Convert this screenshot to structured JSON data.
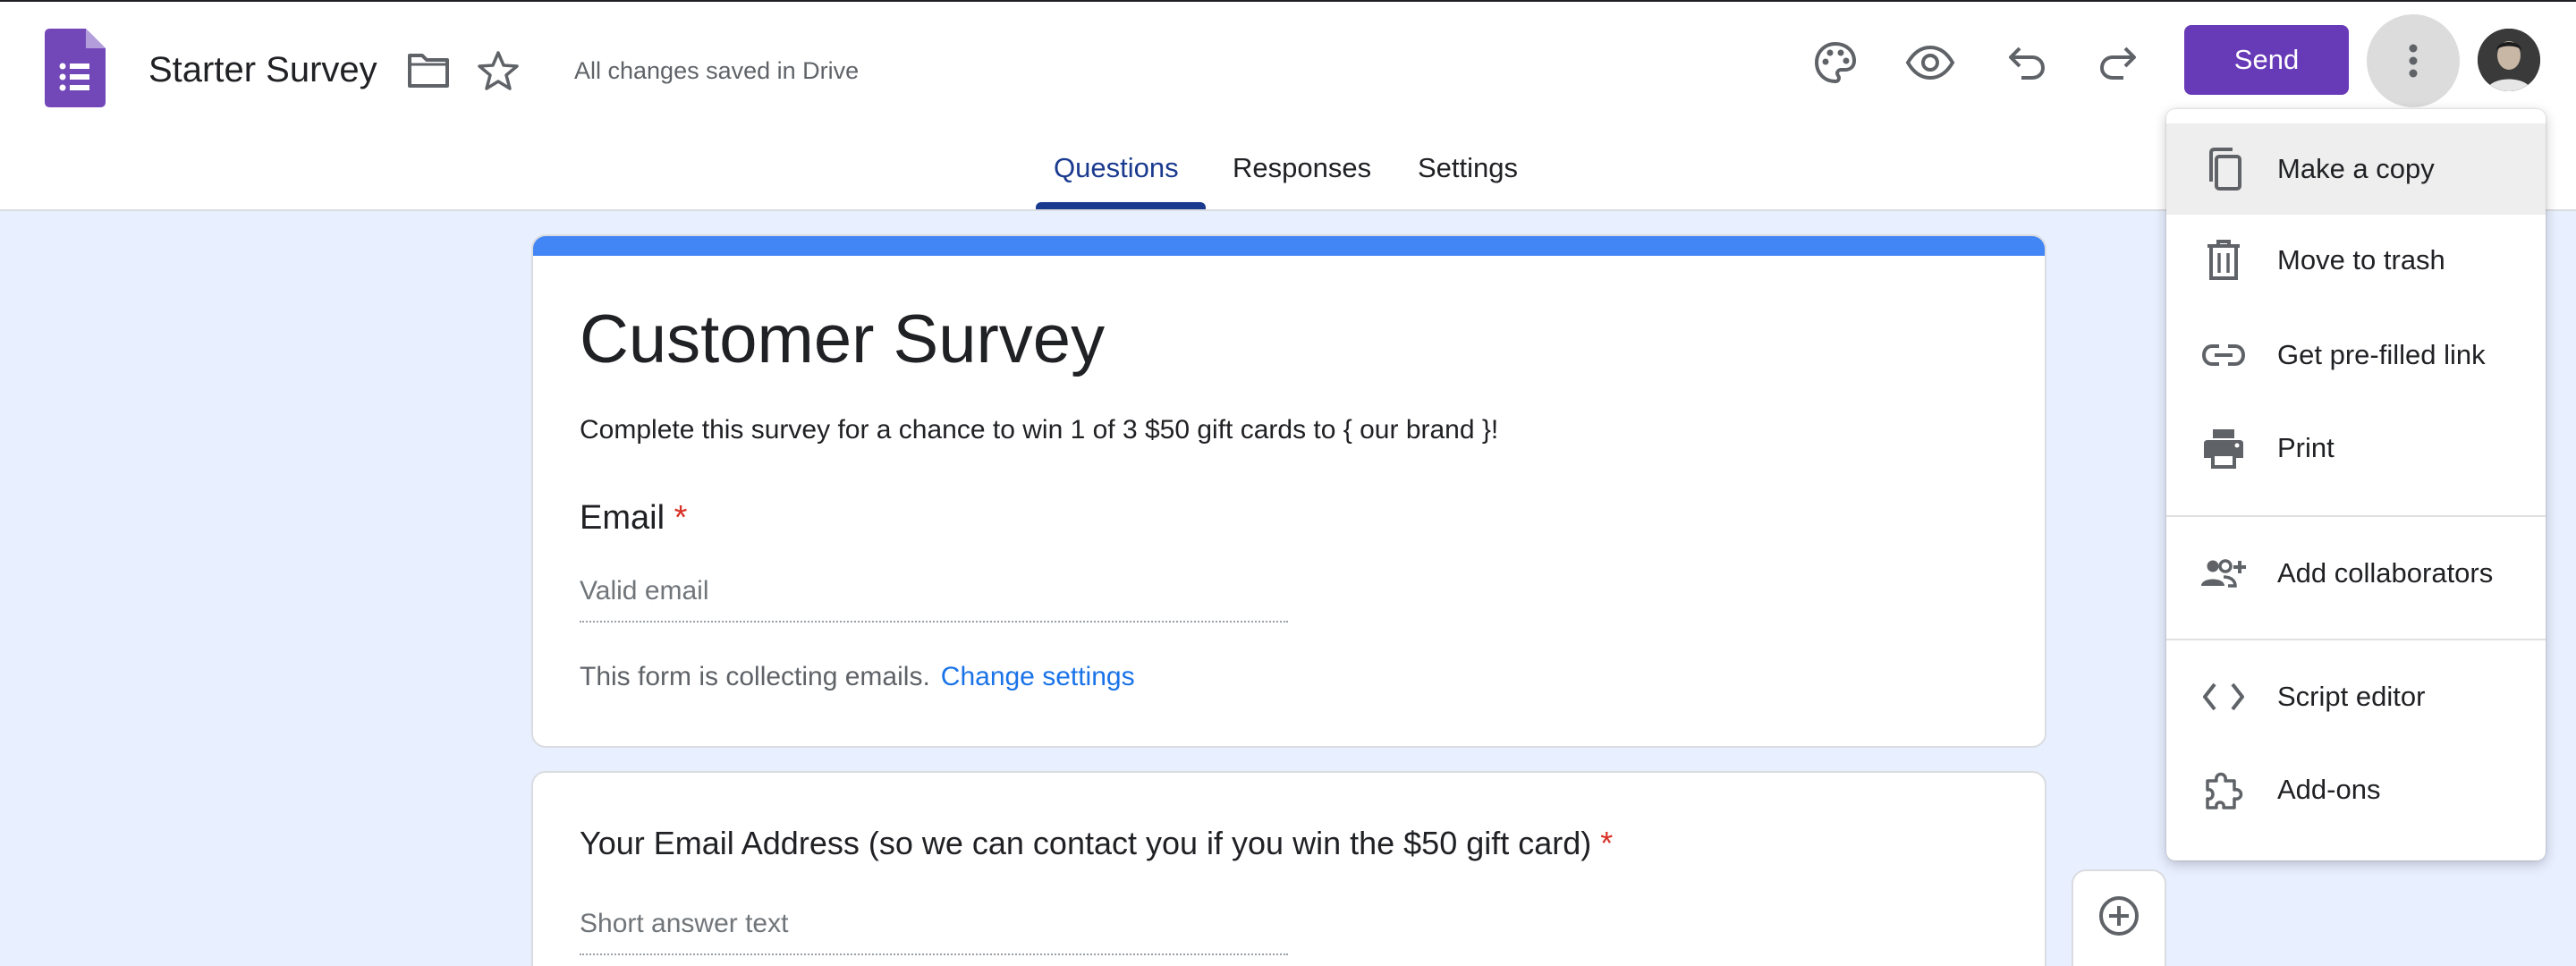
{
  "header": {
    "doc_title": "Starter Survey",
    "save_status": "All changes saved in Drive",
    "send_label": "Send"
  },
  "tabs": [
    {
      "label": "Questions",
      "active": true
    },
    {
      "label": "Responses",
      "active": false
    },
    {
      "label": "Settings",
      "active": false
    }
  ],
  "form": {
    "title": "Customer Survey",
    "description": "Complete this survey for a chance to win 1 of 3 $50 gift cards to { our brand }!",
    "email_label": "Email",
    "required_mark": "*",
    "email_placeholder": "Valid email",
    "collect_note": "This form is collecting emails.",
    "change_settings": "Change settings"
  },
  "question": {
    "title": "Your Email Address (so we can contact you if you win the $50 gift card)",
    "required_mark": "*",
    "placeholder": "Short answer text"
  },
  "menu": {
    "items": [
      {
        "label": "Make a copy",
        "icon": "copy-icon",
        "highlighted": true
      },
      {
        "label": "Move to trash",
        "icon": "trash-icon"
      },
      {
        "label": "Get pre-filled link",
        "icon": "link-icon"
      },
      {
        "label": "Print",
        "icon": "print-icon"
      },
      {
        "label": "Add collaborators",
        "icon": "add-people-icon"
      },
      {
        "label": "Script editor",
        "icon": "code-icon"
      },
      {
        "label": "Add-ons",
        "icon": "puzzle-icon"
      }
    ]
  },
  "colors": {
    "brand_purple": "#673ab7",
    "tab_active": "#1a3a8f",
    "accent_bar": "#4285f4",
    "link": "#1a73e8",
    "required": "#d93025",
    "background": "#e8efff"
  }
}
